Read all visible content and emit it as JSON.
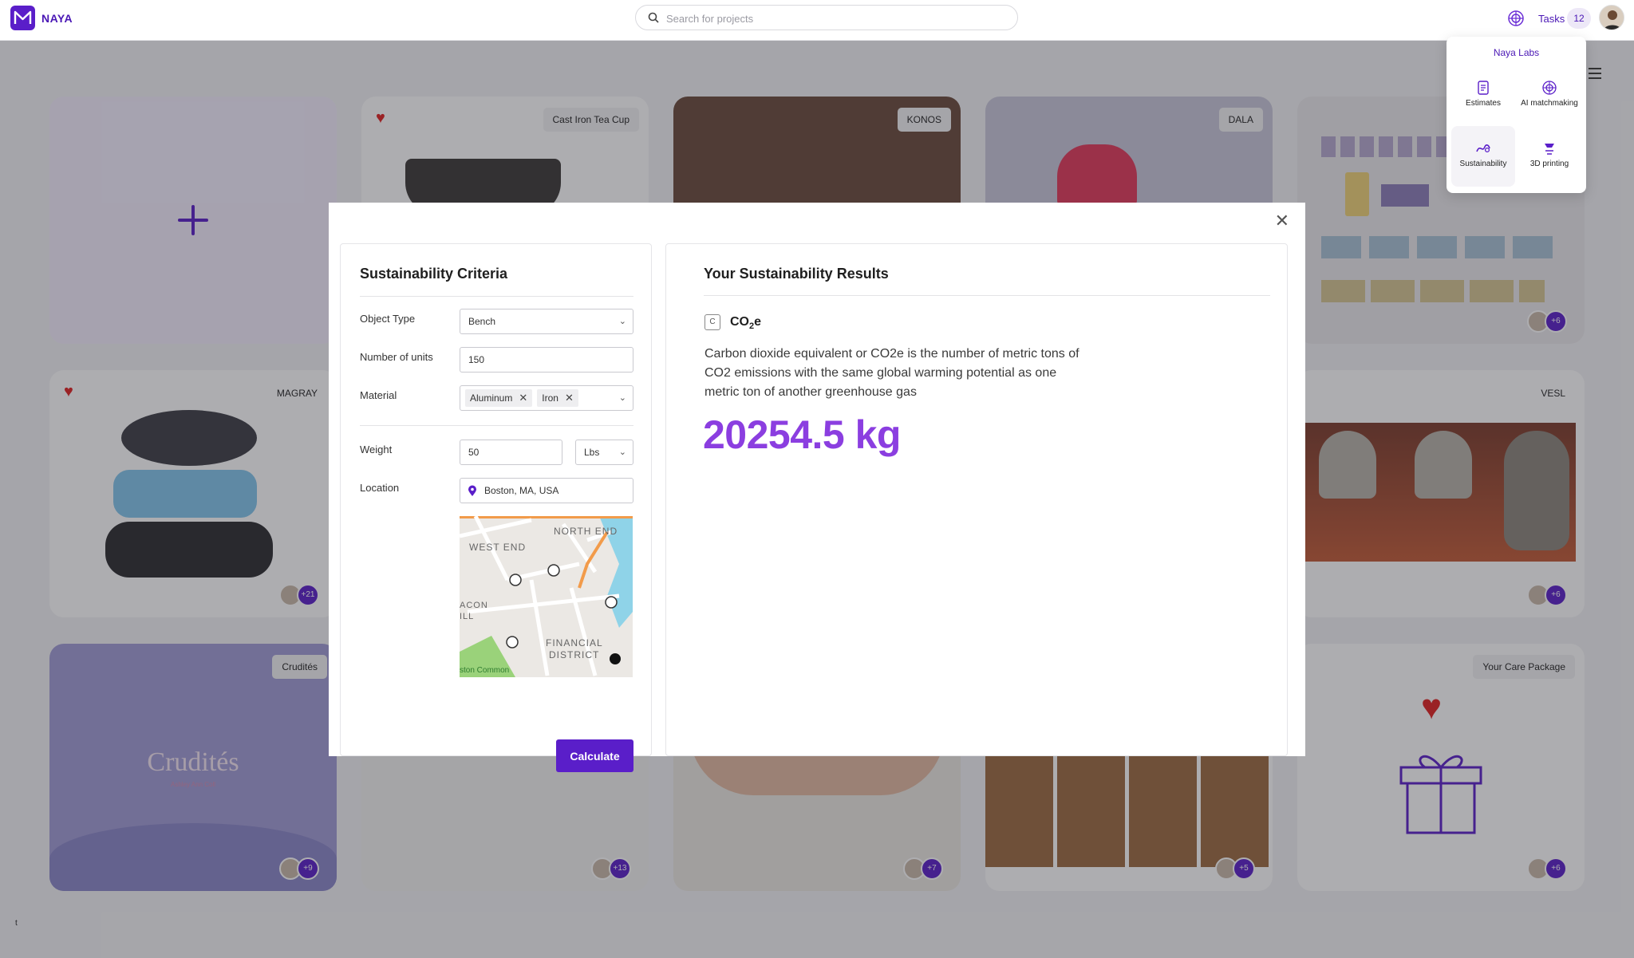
{
  "topbar": {
    "brand": "NAYA",
    "search_placeholder": "Search for projects",
    "tasks_label": "Tasks",
    "tasks_count": "12"
  },
  "board": {
    "cards": [
      {
        "tag": "",
        "avatar_count": ""
      },
      {
        "tag": "Cast Iron Tea Cup",
        "avatar_count": ""
      },
      {
        "tag": "KONOS",
        "avatar_count": ""
      },
      {
        "tag": "DALA",
        "avatar_count": ""
      },
      {
        "tag": "",
        "avatar_count": "+6"
      },
      {
        "tag": "MAGRAY",
        "avatar_count": "+21"
      },
      {
        "tag": "VESL",
        "avatar_count": "+6"
      },
      {
        "tag": "Crudités",
        "avatar_count": "+9",
        "art_title": "Crudités",
        "art_subtitle": "Ashley Ann Coll"
      },
      {
        "tag": "",
        "avatar_count": "+13"
      },
      {
        "tag": "",
        "avatar_count": "+7"
      },
      {
        "tag": "",
        "avatar_count": "+5"
      },
      {
        "tag": "Your Care Package",
        "avatar_count": "+6"
      }
    ]
  },
  "labs_menu": {
    "title": "Naya Labs",
    "items": [
      {
        "label": "Estimates",
        "icon": "estimates-icon"
      },
      {
        "label": "AI matchmaking",
        "icon": "ai-matchmaking-icon"
      },
      {
        "label": "Sustainability",
        "icon": "sustainability-icon"
      },
      {
        "label": "3D printing",
        "icon": "3d-printing-icon"
      }
    ]
  },
  "criteria": {
    "title": "Sustainability Criteria",
    "object_type_label": "Object Type",
    "object_type_value": "Bench",
    "units_label": "Number of units",
    "units_value": "150",
    "material_label": "Material",
    "materials": [
      "Aluminum",
      "Iron"
    ],
    "weight_label": "Weight",
    "weight_value": "50",
    "weight_unit": "Lbs",
    "location_label": "Location",
    "location_value": "Boston, MA, USA",
    "map_labels": {
      "north_end": "NORTH END",
      "west_end": "WEST END",
      "beacon": "ACON",
      "beacon2": "ILL",
      "financial": "FINANCIAL",
      "district": "DISTRICT",
      "common": "ston Common"
    },
    "calculate_label": "Calculate"
  },
  "results": {
    "title": "Your Sustainability Results",
    "badge": "C",
    "metric_main": "CO",
    "metric_sub": "2",
    "metric_tail": "e",
    "description": "Carbon dioxide equivalent or CO2e is the number of metric tons of CO2 emissions with the same global warming potential as one metric ton of another greenhouse gas",
    "value": "20254.5 kg"
  },
  "footer_mark": "t"
}
